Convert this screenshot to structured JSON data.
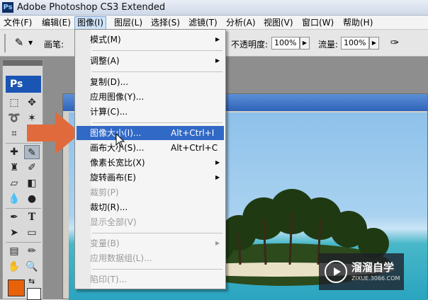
{
  "window": {
    "title": "Adobe Photoshop CS3 Extended",
    "logo": "Ps"
  },
  "menubar": [
    "文件(F)",
    "编辑(E)",
    "图像(I)",
    "图层(L)",
    "选择(S)",
    "滤镜(T)",
    "分析(A)",
    "视图(V)",
    "窗口(W)",
    "帮助(H)"
  ],
  "options": {
    "brush_label": "画笔:",
    "opacity_label": "不透明度:",
    "opacity_value": "100%",
    "flow_label": "流量:",
    "flow_value": "100%"
  },
  "toolbox": {
    "logo": "Ps"
  },
  "image_menu": {
    "items": [
      {
        "label": "模式(M)",
        "submenu": true
      },
      {
        "label": "调整(A)",
        "submenu": true
      },
      {
        "label": "复制(D)..."
      },
      {
        "label": "应用图像(Y)..."
      },
      {
        "label": "计算(C)..."
      },
      {
        "label": "图像大小(I)...",
        "shortcut": "Alt+Ctrl+I",
        "highlighted": true
      },
      {
        "label": "画布大小(S)...",
        "shortcut": "Alt+Ctrl+C"
      },
      {
        "label": "像素长宽比(X)",
        "submenu": true
      },
      {
        "label": "旋转画布(E)",
        "submenu": true
      },
      {
        "label": "裁剪(P)",
        "disabled": true
      },
      {
        "label": "裁切(R)..."
      },
      {
        "label": "显示全部(V)",
        "disabled": true
      },
      {
        "label": "变量(B)",
        "submenu": true,
        "disabled": true
      },
      {
        "label": "应用数据组(L)...",
        "disabled": true
      },
      {
        "label": "陷印(T)...",
        "disabled": true
      }
    ]
  },
  "watermark": {
    "brand": "溜溜自学",
    "url": "ZIXUE.3066.COM"
  },
  "colors": {
    "accent_highlight": "#3169c6",
    "arrow": "#e06a3c",
    "foreground_swatch": "#e8620a"
  }
}
